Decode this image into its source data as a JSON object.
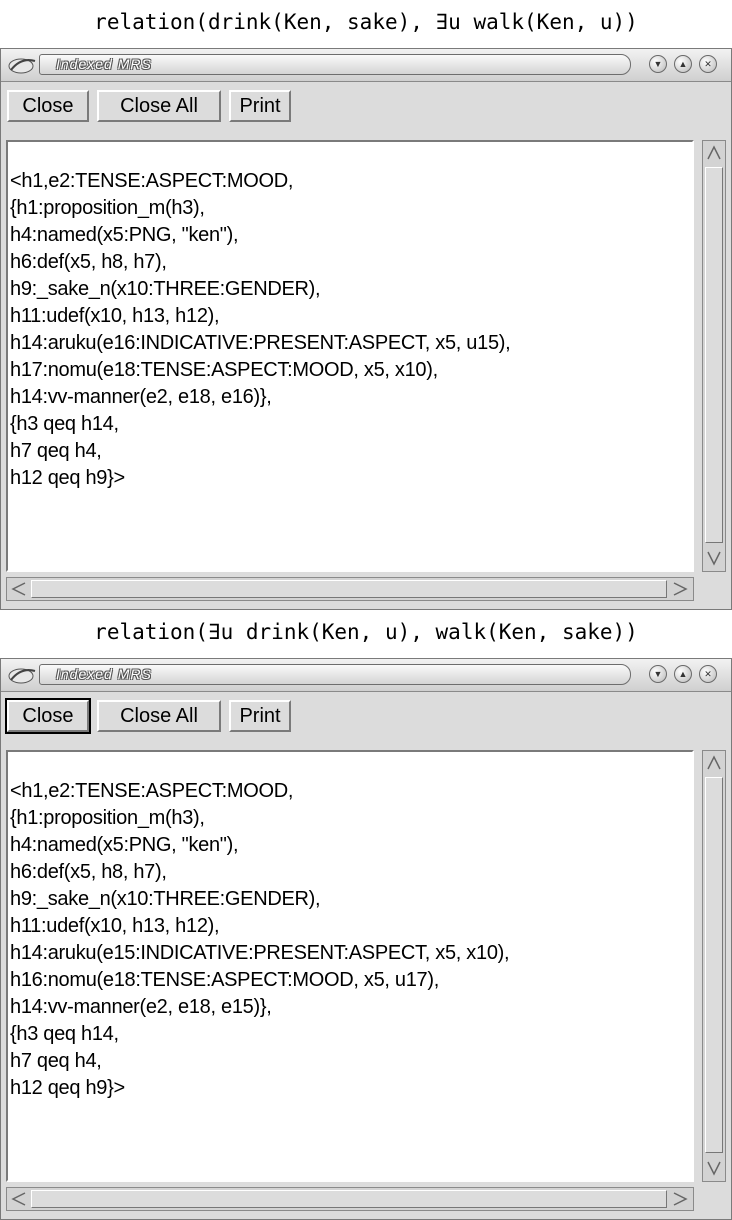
{
  "panels": [
    {
      "caption": "relation(drink(Ken, sake), ∃u walk(Ken, u))",
      "window_title": "Indexed MRS",
      "buttons": {
        "close": "Close",
        "close_all": "Close All",
        "print": "Print"
      },
      "close_focused": false,
      "lines": [
        "<h1,e2:TENSE:ASPECT:MOOD,",
        "{h1:proposition_m(h3),",
        "h4:named(x5:PNG, \"ken\"),",
        "h6:def(x5, h8, h7),",
        "h9:_sake_n(x10:THREE:GENDER),",
        "h11:udef(x10, h13, h12),",
        "h14:aruku(e16:INDICATIVE:PRESENT:ASPECT, x5, u15),",
        "h17:nomu(e18:TENSE:ASPECT:MOOD, x5, x10),",
        "h14:vv-manner(e2, e18, e16)},",
        "{h3 qeq h14,",
        "h7 qeq h4,",
        "h12 qeq h9}>"
      ]
    },
    {
      "caption": "relation(∃u drink(Ken, u), walk(Ken, sake))",
      "window_title": "Indexed MRS",
      "buttons": {
        "close": "Close",
        "close_all": "Close All",
        "print": "Print"
      },
      "close_focused": true,
      "lines": [
        "<h1,e2:TENSE:ASPECT:MOOD,",
        "{h1:proposition_m(h3),",
        "h4:named(x5:PNG, \"ken\"),",
        "h6:def(x5, h8, h7),",
        "h9:_sake_n(x10:THREE:GENDER),",
        "h11:udef(x10, h13, h12),",
        "h14:aruku(e15:INDICATIVE:PRESENT:ASPECT, x5, x10),",
        "h16:nomu(e18:TENSE:ASPECT:MOOD, x5, u17),",
        "h14:vv-manner(e2, e18, e15)},",
        "{h3 qeq h14,",
        "h7 qeq h4,",
        "h12 qeq h9}>"
      ]
    }
  ]
}
